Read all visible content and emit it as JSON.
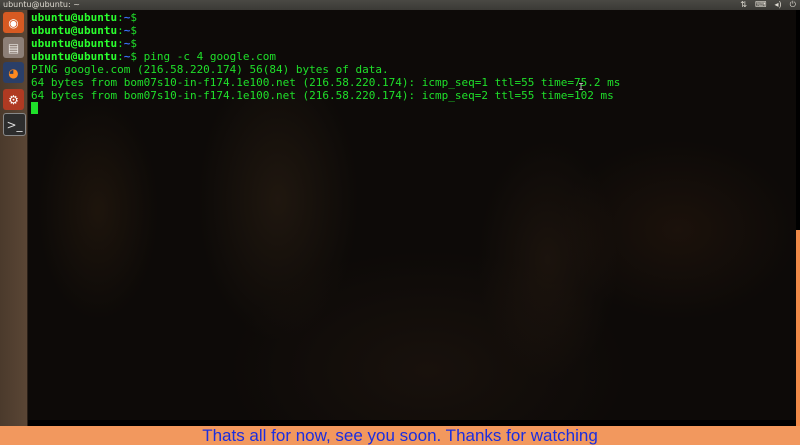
{
  "window": {
    "title": "ubuntu@ubuntu: ~"
  },
  "tray": {
    "icons": [
      "sort-arrows-icon",
      "keyboard-icon",
      "volume-icon",
      "power-icon"
    ]
  },
  "launcher": {
    "items": [
      "dash-home",
      "files",
      "firefox",
      "system-settings",
      "terminal"
    ]
  },
  "terminal": {
    "user": "ubuntu@ubuntu",
    "path_sep": ":",
    "path": "~",
    "prompt_end": "$",
    "lines": [
      {
        "type": "prompt",
        "command": ""
      },
      {
        "type": "prompt",
        "command": ""
      },
      {
        "type": "prompt",
        "command": ""
      },
      {
        "type": "prompt",
        "command": " ping -c 4 google.com"
      },
      {
        "type": "output",
        "text": "PING google.com (216.58.220.174) 56(84) bytes of data."
      },
      {
        "type": "output",
        "text": "64 bytes from bom07s10-in-f174.1e100.net (216.58.220.174): icmp_seq=1 ttl=55 time=75.2 ms"
      },
      {
        "type": "output",
        "text": "64 bytes from bom07s10-in-f174.1e100.net (216.58.220.174): icmp_seq=2 ttl=55 time=102 ms"
      }
    ]
  },
  "caption": {
    "text": "Thats all for now, see you soon. Thanks for watching"
  }
}
